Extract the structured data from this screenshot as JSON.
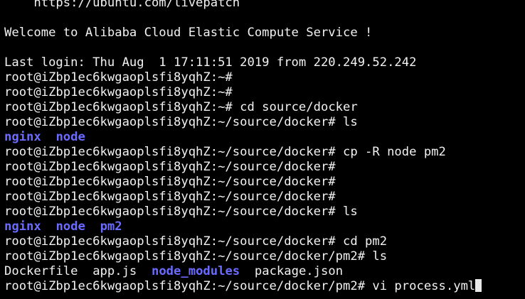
{
  "terminal": {
    "livepatch_url": "    https://ubuntu.com/livepatch",
    "welcome": "Welcome to Alibaba Cloud Elastic Compute Service !",
    "last_login": "Last login: Thu Aug  1 17:11:51 2019 from 220.249.52.242",
    "prompt_home": "root@iZbp1ec6kwgaoplsfi8yqhZ:~# ",
    "prompt_docker": "root@iZbp1ec6kwgaoplsfi8yqhZ:~/source/docker# ",
    "prompt_pm2": "root@iZbp1ec6kwgaoplsfi8yqhZ:~/source/docker/pm2# ",
    "commands": {
      "cd_docker": "cd source/docker",
      "ls": "ls",
      "cp": "cp -R node pm2",
      "cd_pm2": "cd pm2",
      "vi": "vi process.yml"
    },
    "listing1": [
      "nginx",
      "node"
    ],
    "listing2": [
      "nginx",
      "node",
      "pm2"
    ],
    "listing3": {
      "dockerfile": "Dockerfile",
      "appjs": "app.js",
      "node_modules": "node_modules",
      "package_json": "package.json"
    },
    "colors": {
      "background": "#000000",
      "text": "#f2f2f2",
      "directory": "#6b6bff"
    }
  }
}
